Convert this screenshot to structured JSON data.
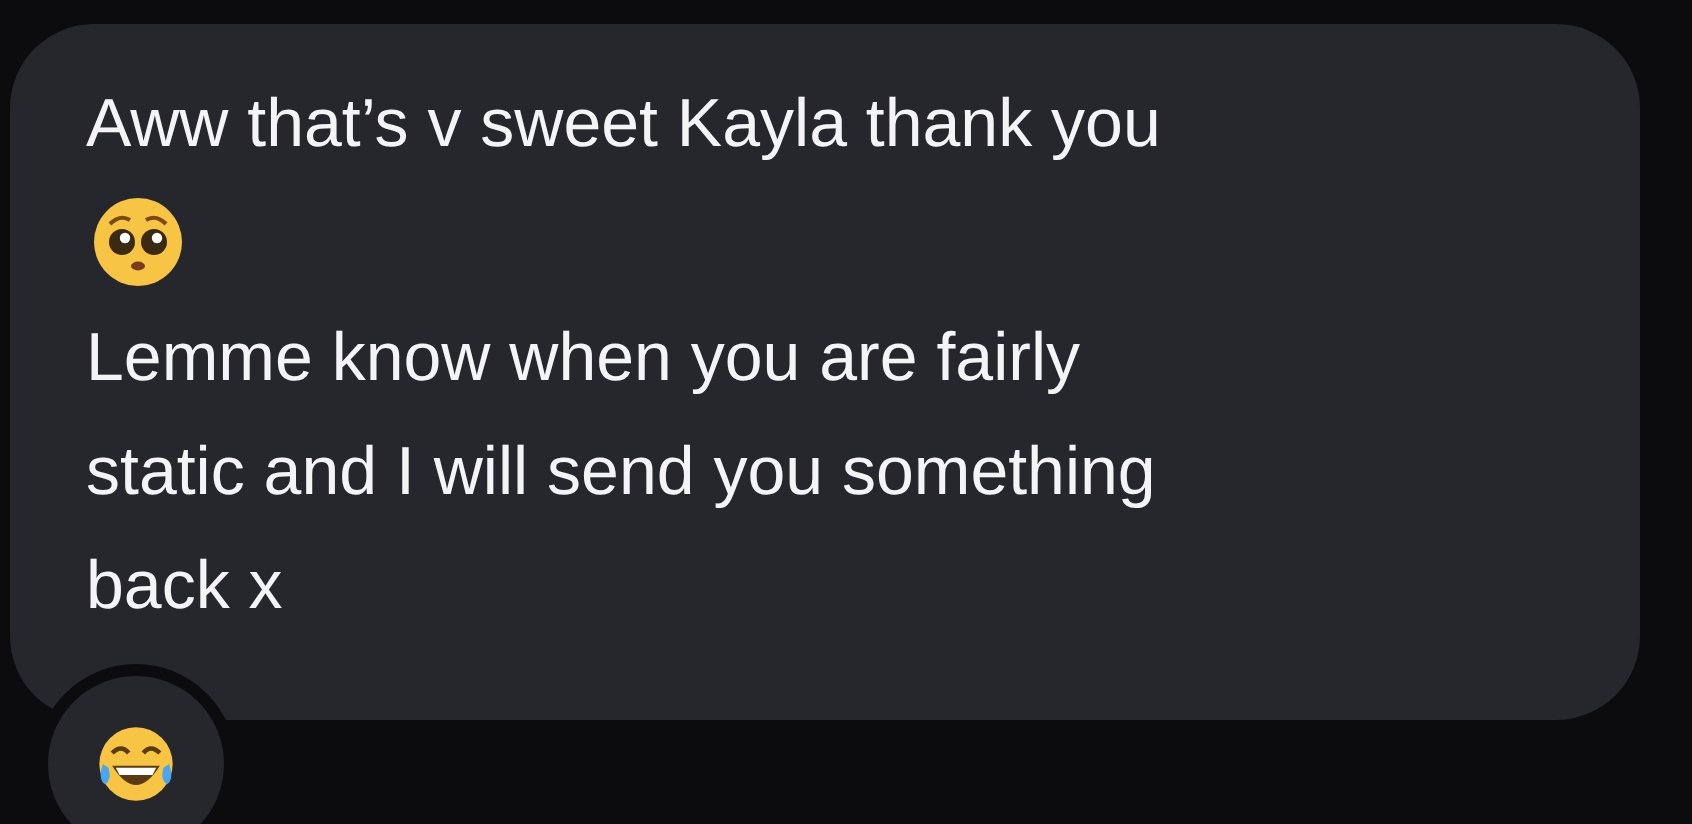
{
  "message": {
    "first_line": "Aww that’s v sweet Kayla thank you",
    "body_lines": [
      "Lemme know when you are fairly",
      "static and I will send you something",
      "back x"
    ]
  },
  "reaction": {
    "kind": "laugh"
  }
}
